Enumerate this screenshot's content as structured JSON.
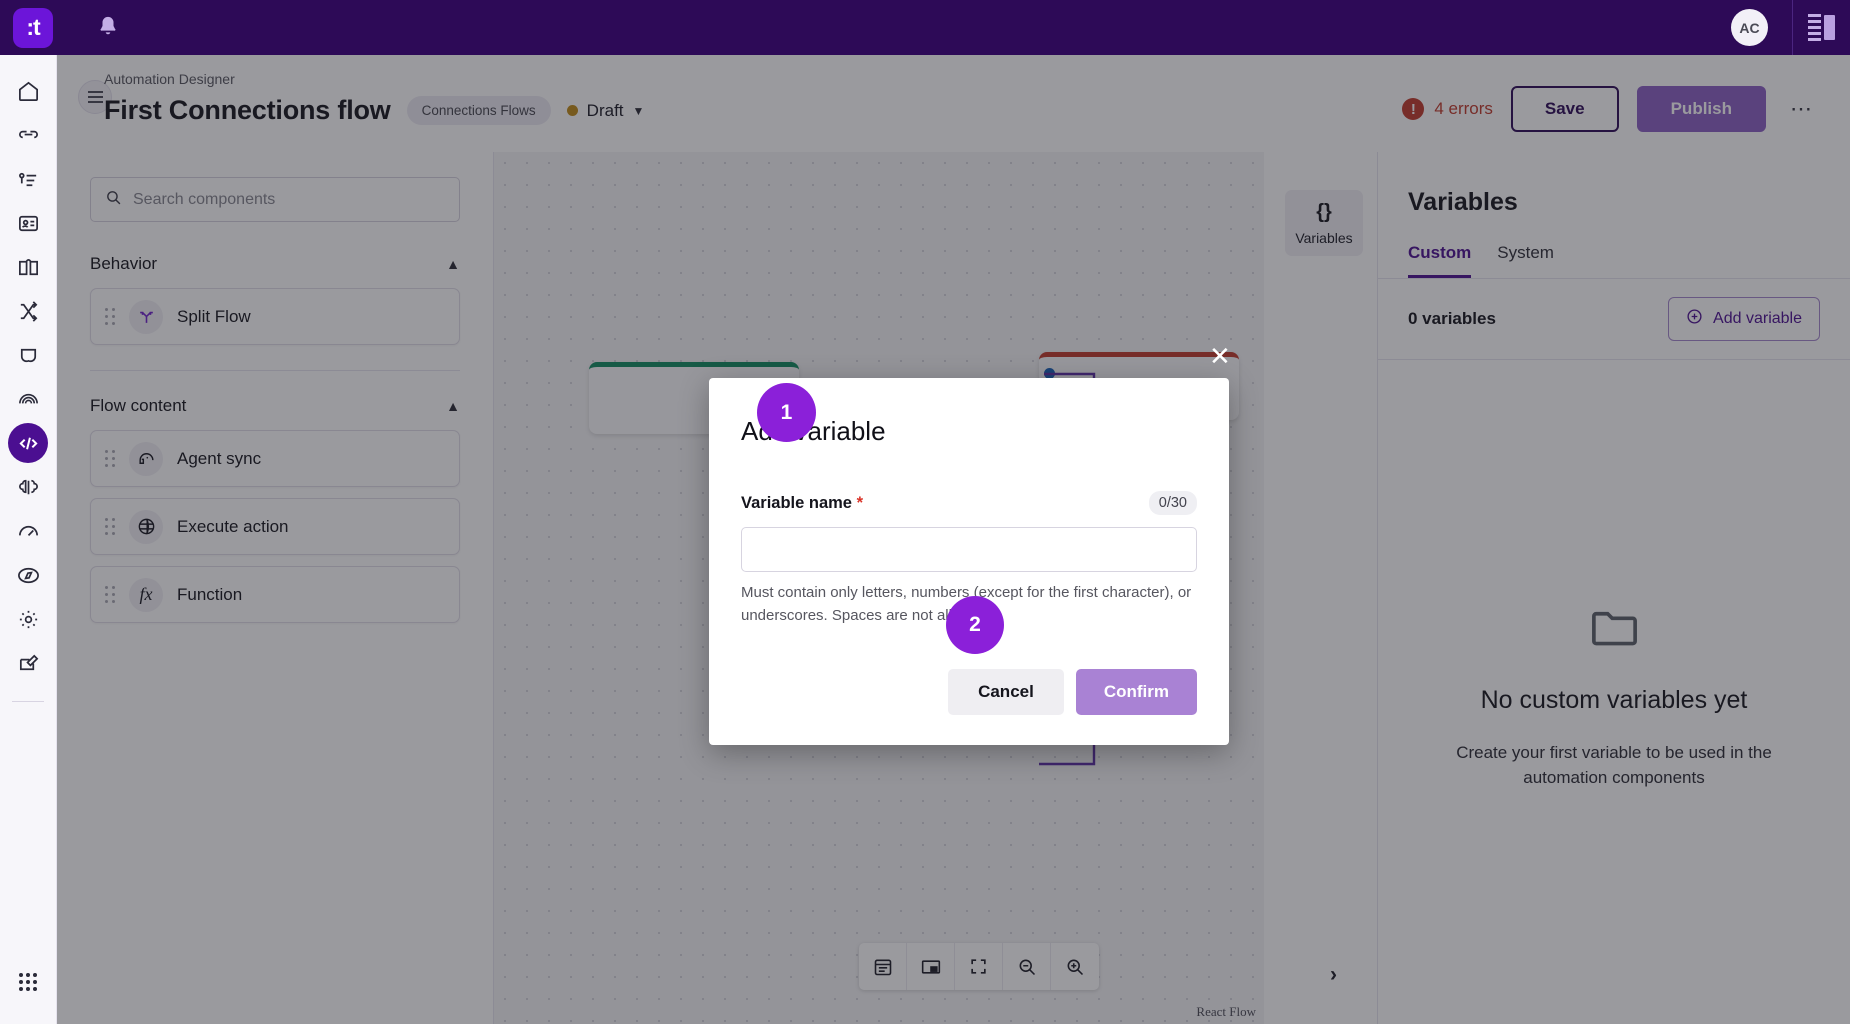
{
  "topbar": {
    "logo_text": ":t",
    "bell_icon": "bell-icon",
    "avatar_initials": "AC",
    "panel_toggle_icon": "side-panel-toggle-icon"
  },
  "rail": {
    "items": [
      {
        "name": "home",
        "icon": "home-icon"
      },
      {
        "name": "connections",
        "icon": "link-icon"
      },
      {
        "name": "queue",
        "icon": "list-icon"
      },
      {
        "name": "contacts",
        "icon": "contact-card-icon"
      },
      {
        "name": "knowledge",
        "icon": "book-icon"
      },
      {
        "name": "routing",
        "icon": "shuffle-icon"
      },
      {
        "name": "shield",
        "icon": "shield-icon"
      },
      {
        "name": "insights",
        "icon": "fingerprint-icon"
      },
      {
        "name": "automation-designer",
        "icon": "code-icon",
        "active": true
      },
      {
        "name": "ai",
        "icon": "brain-icon"
      },
      {
        "name": "performance",
        "icon": "gauge-icon"
      },
      {
        "name": "explore",
        "icon": "compass-icon"
      },
      {
        "name": "settings",
        "icon": "gear-icon"
      },
      {
        "name": "compose",
        "icon": "edit-square-icon"
      }
    ],
    "bottom_icon": "apps-grid-icon"
  },
  "header": {
    "menu_icon": "hamburger-icon",
    "breadcrumb": "Automation Designer",
    "title": "First Connections flow",
    "chip": "Connections Flows",
    "status": "Draft",
    "status_color": "#c08a16",
    "status_caret_icon": "chevron-down-icon",
    "errors_text": "4 errors",
    "errors_color": "#c0392b",
    "error_icon": "alert-circle-icon",
    "save_label": "Save",
    "publish_label": "Publish",
    "more_icon": "more-horizontal-icon"
  },
  "components_panel": {
    "search_placeholder": "Search components",
    "search_icon": "search-icon",
    "sections": [
      {
        "title": "Behavior",
        "collapse_icon": "chevron-up-icon",
        "items": [
          {
            "label": "Split Flow",
            "icon": "split-flow-icon"
          }
        ]
      },
      {
        "title": "Flow content",
        "collapse_icon": "chevron-up-icon",
        "items": [
          {
            "label": "Agent sync",
            "icon": "agent-headset-icon"
          },
          {
            "label": "Execute action",
            "icon": "globe-icon"
          },
          {
            "label": "Function",
            "icon": "fx-icon"
          }
        ]
      }
    ]
  },
  "canvas": {
    "toolbar": [
      {
        "name": "notes",
        "icon": "note-card-icon"
      },
      {
        "name": "minimap",
        "icon": "minimap-icon"
      },
      {
        "name": "fit-view",
        "icon": "fit-screen-icon"
      },
      {
        "name": "zoom-out",
        "icon": "zoom-out-icon"
      },
      {
        "name": "zoom-in",
        "icon": "zoom-in-icon"
      }
    ],
    "attribution": "React Flow",
    "expand_icon": "chevron-right-icon"
  },
  "variables_tab": {
    "icon_text": "{}",
    "label": "Variables"
  },
  "variables_panel": {
    "title": "Variables",
    "tabs": [
      {
        "label": "Custom",
        "active": true
      },
      {
        "label": "System",
        "active": false
      }
    ],
    "count_text": "0 variables",
    "add_button_label": "Add variable",
    "add_button_icon": "plus-circle-icon",
    "empty_icon": "folder-icon",
    "empty_title": "No custom variables yet",
    "empty_subtitle": "Create your first variable to be used in the automation components"
  },
  "modal": {
    "close_icon": "close-icon",
    "title": "Add variable",
    "field_label": "Variable name",
    "required_mark": "*",
    "counter": "0/30",
    "input_value": "",
    "input_placeholder": "",
    "helper_text": "Must contain only letters, numbers (except for the first character), or underscores. Spaces are not allowed",
    "cancel_label": "Cancel",
    "confirm_label": "Confirm"
  },
  "markers": {
    "one": "1",
    "two": "2",
    "color": "#8b20d9"
  }
}
